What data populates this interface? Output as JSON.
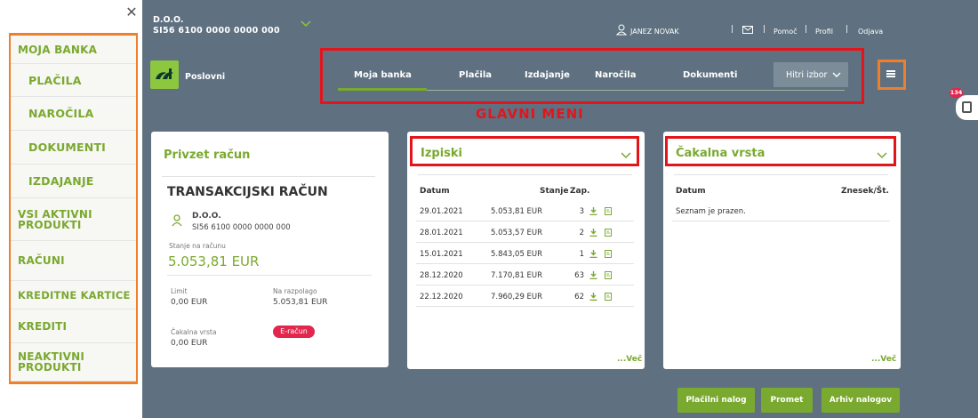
{
  "side_menu": {
    "items": [
      {
        "label": "MOJA BANKA"
      },
      {
        "label": "PLAČILA"
      },
      {
        "label": "NAROČILA"
      },
      {
        "label": "DOKUMENTI"
      },
      {
        "label": "IZDAJANJE"
      },
      {
        "label": "VSI AKTIVNI PRODUKTI"
      },
      {
        "label": "RAČUNI"
      },
      {
        "label": "KREDITNE KARTICE"
      },
      {
        "label": "KREDITI"
      },
      {
        "label": "NEAKTIVNI PRODUKTI"
      }
    ]
  },
  "header": {
    "account_name": "D.O.O.",
    "account_iban": "SI56 6100 0000 0000 000",
    "user": "JANEZ NOVAK",
    "links": {
      "help": "Pomoč",
      "profile": "Profil",
      "logout": "Odjava"
    },
    "separator": "|"
  },
  "brand": {
    "name": "Poslovni"
  },
  "nav": {
    "tabs": [
      "Moja banka",
      "Plačila",
      "Izdajanje",
      "Naročila",
      "Dokumenti"
    ],
    "active_tab": "Moja banka",
    "quick_select": "Hitri izbor"
  },
  "annotation": {
    "main_menu": "GLAVNI MENI"
  },
  "notifications": {
    "count": "134"
  },
  "account_card": {
    "title": "Privzet račun",
    "account_type": "TRANSAKCIJSKI RAČUN",
    "holder": "D.O.O.",
    "iban": "SI56 6100 0000 0000 000",
    "balance_label": "Stanje na računu",
    "balance": "5.053,81 EUR",
    "limit_label": "Limit",
    "limit": "0,00 EUR",
    "available_label": "Na razpolago",
    "available": "5.053,81 EUR",
    "queue_label": "Čakalna vrsta",
    "queue": "0,00 EUR",
    "erachun_badge": "E-račun"
  },
  "statements_card": {
    "title": "Izpiski",
    "columns": [
      "Datum",
      "Stanje",
      "Zap."
    ],
    "rows": [
      {
        "date": "29.01.2021",
        "balance": "5.053,81 EUR",
        "no": "3"
      },
      {
        "date": "28.01.2021",
        "balance": "5.053,57 EUR",
        "no": "2"
      },
      {
        "date": "15.01.2021",
        "balance": "5.843,05 EUR",
        "no": "1"
      },
      {
        "date": "28.12.2020",
        "balance": "7.170,81 EUR",
        "no": "63"
      },
      {
        "date": "22.12.2020",
        "balance": "7.960,29 EUR",
        "no": "62"
      }
    ],
    "more": "...Več"
  },
  "queue_card": {
    "title": "Čakalna vrsta",
    "columns": [
      "Datum",
      "Znesek/Št."
    ],
    "empty": "Seznam je prazen.",
    "more": "...Več"
  },
  "actions": {
    "payment_order": "Plačilni nalog",
    "turnover": "Promet",
    "orders_archive": "Arhiv nalogov"
  },
  "colors": {
    "accent": "#7aa92f",
    "highlight_red": "#e3151c",
    "highlight_orange": "#f07f2b",
    "background": "#5f7180"
  }
}
